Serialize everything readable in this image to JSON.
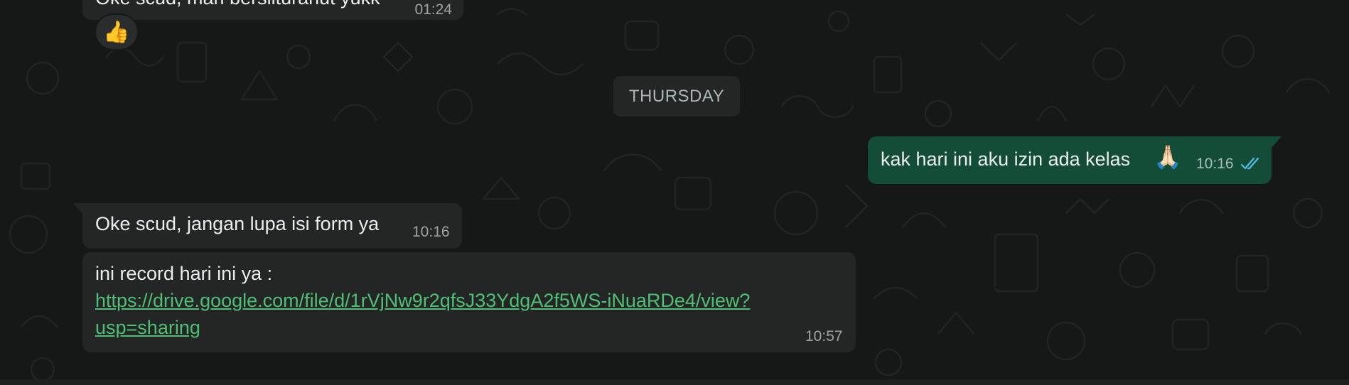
{
  "date_separator": "THURSDAY",
  "messages": [
    {
      "id": "m0",
      "direction": "incoming",
      "text": "Oke scud, mari bersilturahut yukk",
      "time": "01:24",
      "reaction": "👍"
    },
    {
      "id": "m1",
      "direction": "outgoing",
      "text": "kak hari ini aku izin ada kelas",
      "emoji": "🙏🏻",
      "time": "10:16",
      "status": "read"
    },
    {
      "id": "m2",
      "direction": "incoming",
      "text": "Oke scud, jangan lupa isi form ya",
      "time": "10:16"
    },
    {
      "id": "m3",
      "direction": "incoming",
      "text": "ini record hari ini ya :",
      "link_line1": "https://drive.google.com/file/d/1rVjNw9r2qfsJ33YdgA2f5WS-iNuaRDe4/view?",
      "link_line2": "usp=sharing",
      "time": "10:57"
    }
  ],
  "colors": {
    "background": "#161717",
    "incoming_bubble": "#242626",
    "outgoing_bubble": "#134d37",
    "link": "#4fbf76",
    "read_ticks": "#53bdeb"
  }
}
